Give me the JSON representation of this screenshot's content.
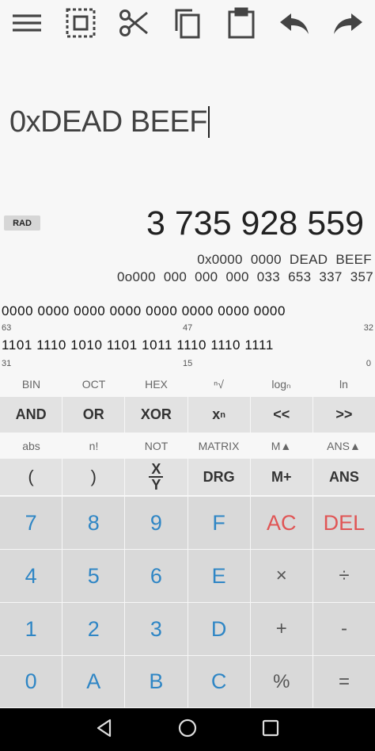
{
  "expression": "0xDEAD BEEF",
  "angle_mode": "RAD",
  "result": "3 735 928 559",
  "hex_line": "0x0000  0000  DEAD  BEEF",
  "oct_line": "0o000  000  000  000  033  653  337  357",
  "bits": {
    "row1": "0000 0000 0000 0000 0000 0000 0000 0000",
    "row1_idx": [
      "63",
      "47",
      "32"
    ],
    "row2": "1101 1110 1010 1101 1011 1110 1110 1111",
    "row2_idx": [
      "31",
      "15",
      "0"
    ]
  },
  "secondary1": [
    "BIN",
    "OCT",
    "HEX",
    "ⁿ√",
    "logₙ",
    "ln"
  ],
  "row1": [
    "AND",
    "OR",
    "XOR",
    "x",
    "<<",
    ">>"
  ],
  "row1_sup": "n",
  "secondary2": [
    "abs",
    "n!",
    "NOT",
    "MATRIX",
    "M▲",
    "ANS▲"
  ],
  "row2": [
    "(",
    ")",
    "X",
    "Y",
    "DRG",
    "M+",
    "ANS"
  ],
  "row3": [
    "7",
    "8",
    "9",
    "F",
    "AC",
    "DEL"
  ],
  "row4": [
    "4",
    "5",
    "6",
    "E",
    "×",
    "÷"
  ],
  "row5": [
    "1",
    "2",
    "3",
    "D",
    "+",
    "-"
  ],
  "row6": [
    "0",
    "A",
    "B",
    "C",
    "%",
    "="
  ],
  "icons": [
    "menu-icon",
    "select-all-icon",
    "cut-icon",
    "copy-icon",
    "paste-icon",
    "undo-icon",
    "redo-icon"
  ],
  "colors": {
    "digit": "#2f86c5",
    "danger": "#e05555"
  }
}
